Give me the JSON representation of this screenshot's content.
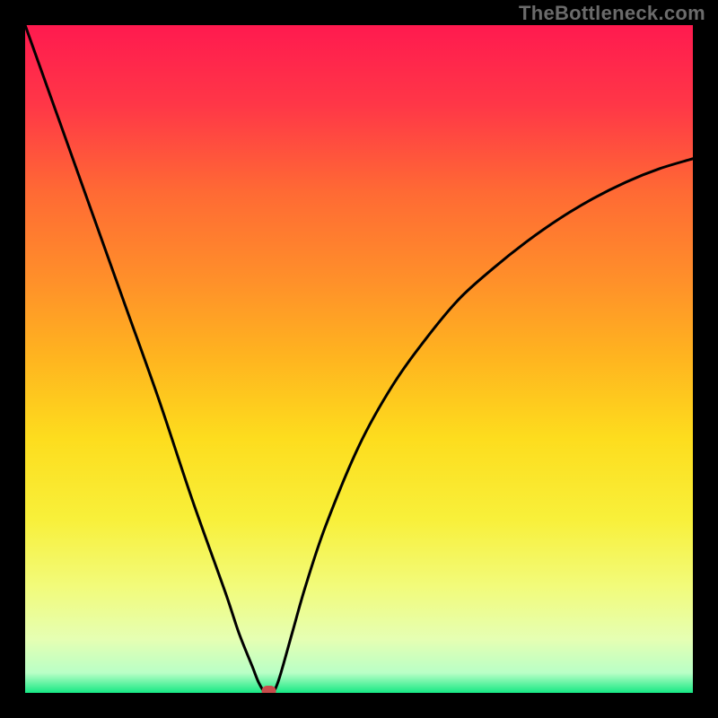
{
  "watermark": "TheBottleneck.com",
  "chart_data": {
    "type": "line",
    "title": "",
    "xlabel": "",
    "ylabel": "",
    "xlim": [
      0,
      100
    ],
    "ylim": [
      0,
      100
    ],
    "grid": false,
    "legend": false,
    "annotations": [],
    "series": [
      {
        "name": "curve",
        "x": [
          0,
          5,
          10,
          15,
          20,
          25,
          30,
          32,
          34,
          35,
          36,
          37,
          38,
          40,
          42,
          45,
          50,
          55,
          60,
          65,
          70,
          75,
          80,
          85,
          90,
          95,
          100
        ],
        "y": [
          100,
          86,
          72,
          58,
          44,
          29,
          15,
          9,
          4,
          1.5,
          0,
          0,
          2,
          9,
          16,
          25,
          37,
          46,
          53,
          59,
          63.5,
          67.5,
          71,
          74,
          76.5,
          78.5,
          80
        ]
      }
    ],
    "minimum_marker": {
      "x": 36.5,
      "y": 0
    },
    "background_gradient": {
      "stops": [
        {
          "offset": 0.0,
          "color": "#ff1a4f"
        },
        {
          "offset": 0.12,
          "color": "#ff3747"
        },
        {
          "offset": 0.25,
          "color": "#ff6a34"
        },
        {
          "offset": 0.38,
          "color": "#ff8f2a"
        },
        {
          "offset": 0.5,
          "color": "#ffb51f"
        },
        {
          "offset": 0.62,
          "color": "#fddd1e"
        },
        {
          "offset": 0.74,
          "color": "#f8f03a"
        },
        {
          "offset": 0.84,
          "color": "#f2fb7a"
        },
        {
          "offset": 0.92,
          "color": "#e5ffb3"
        },
        {
          "offset": 0.97,
          "color": "#b9ffc6"
        },
        {
          "offset": 1.0,
          "color": "#16e884"
        }
      ]
    }
  }
}
